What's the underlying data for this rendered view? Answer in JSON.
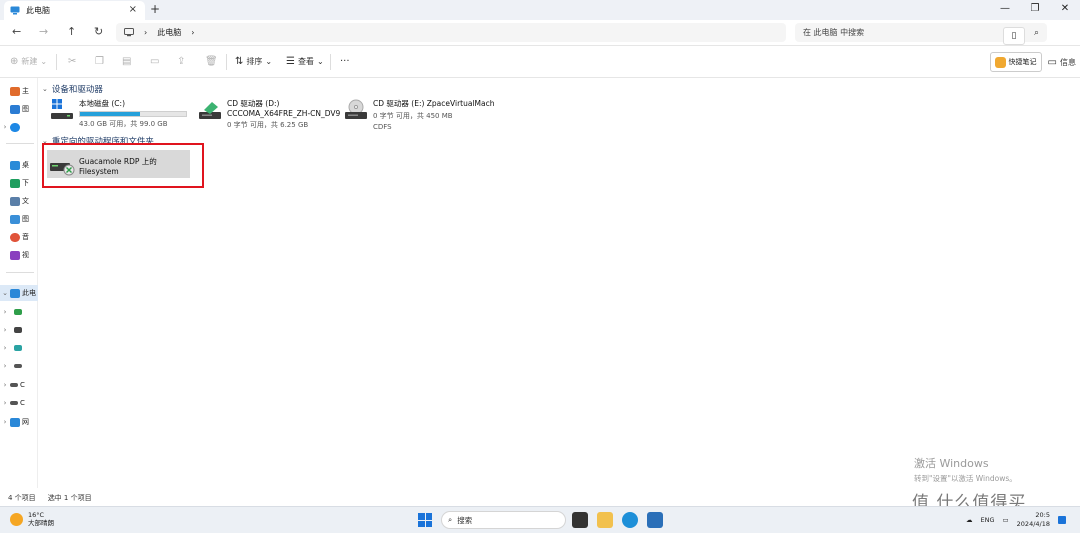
{
  "window": {
    "tab_title": "此电脑",
    "tab_close": "×",
    "new_tab": "+",
    "minimize": "—",
    "restore": "❐",
    "close": "✕"
  },
  "address": {
    "path": [
      "此电脑"
    ],
    "search_placeholder": "在 此电脑 中搜索"
  },
  "toolbar": {
    "new_label": "新建",
    "sort_label": "排序",
    "view_label": "查看",
    "more_label": "···",
    "quick_notes_label": "快捷笔记",
    "details_label": "信息"
  },
  "sidebar": {
    "items": [
      {
        "label": "主",
        "color": "#e06b2c"
      },
      {
        "label": "图",
        "color": "#2b7cd3"
      },
      {
        "label": "",
        "color": "#1e88e5"
      },
      {
        "label": "桌",
        "color": "#2a8bd8"
      },
      {
        "label": "下",
        "color": "#1e9e5e"
      },
      {
        "label": "文",
        "color": "#5a7fa8"
      },
      {
        "label": "图",
        "color": "#3a8fd8"
      },
      {
        "label": "音",
        "color": "#e0543a"
      },
      {
        "label": "视",
        "color": "#8a3fbf"
      },
      {
        "label": "此电",
        "color": "#2a88d8"
      },
      {
        "label": "",
        "color": "#2f9e4a"
      },
      {
        "label": "",
        "color": "#444444"
      },
      {
        "label": "",
        "color": "#2aa3a3"
      },
      {
        "label": "",
        "color": "#555555"
      },
      {
        "label": "C",
        "color": "#555555"
      },
      {
        "label": "C",
        "color": "#555555"
      },
      {
        "label": "网",
        "color": "#2a88d8"
      }
    ]
  },
  "groups": {
    "devices_title": "设备和驱动器",
    "redirected_title": "重定向的驱动程序和文件夹"
  },
  "drives": [
    {
      "name": "本地磁盘 (C:)",
      "sub": "43.0 GB 可用，共 99.0 GB",
      "used_fraction": 0.57
    },
    {
      "name": "CD 驱动器 (D:)",
      "name2": "CCCOMA_X64FRE_ZH-CN_DV9",
      "sub": "0 字节 可用，共 6.25 GB"
    },
    {
      "name": "CD 驱动器 (E:) ZpaceVirtualMach",
      "sub": "0 字节 可用，共 450 MB",
      "sub2": "CDFS"
    }
  ],
  "network_drive": {
    "name": "Guacamole RDP 上的 Filesystem"
  },
  "status": {
    "count": "4 个项目",
    "selected": "选中 1 个项目"
  },
  "watermark": {
    "line1": "激活 Windows",
    "line2": "转到\"设置\"以激活 Windows。"
  },
  "brand": "值 什么值得买",
  "taskbar": {
    "temp": "16°C",
    "weather": "大部晴朗",
    "search": "搜索",
    "lang": "ENG",
    "time": "20:5",
    "date": "2024/4/18"
  }
}
